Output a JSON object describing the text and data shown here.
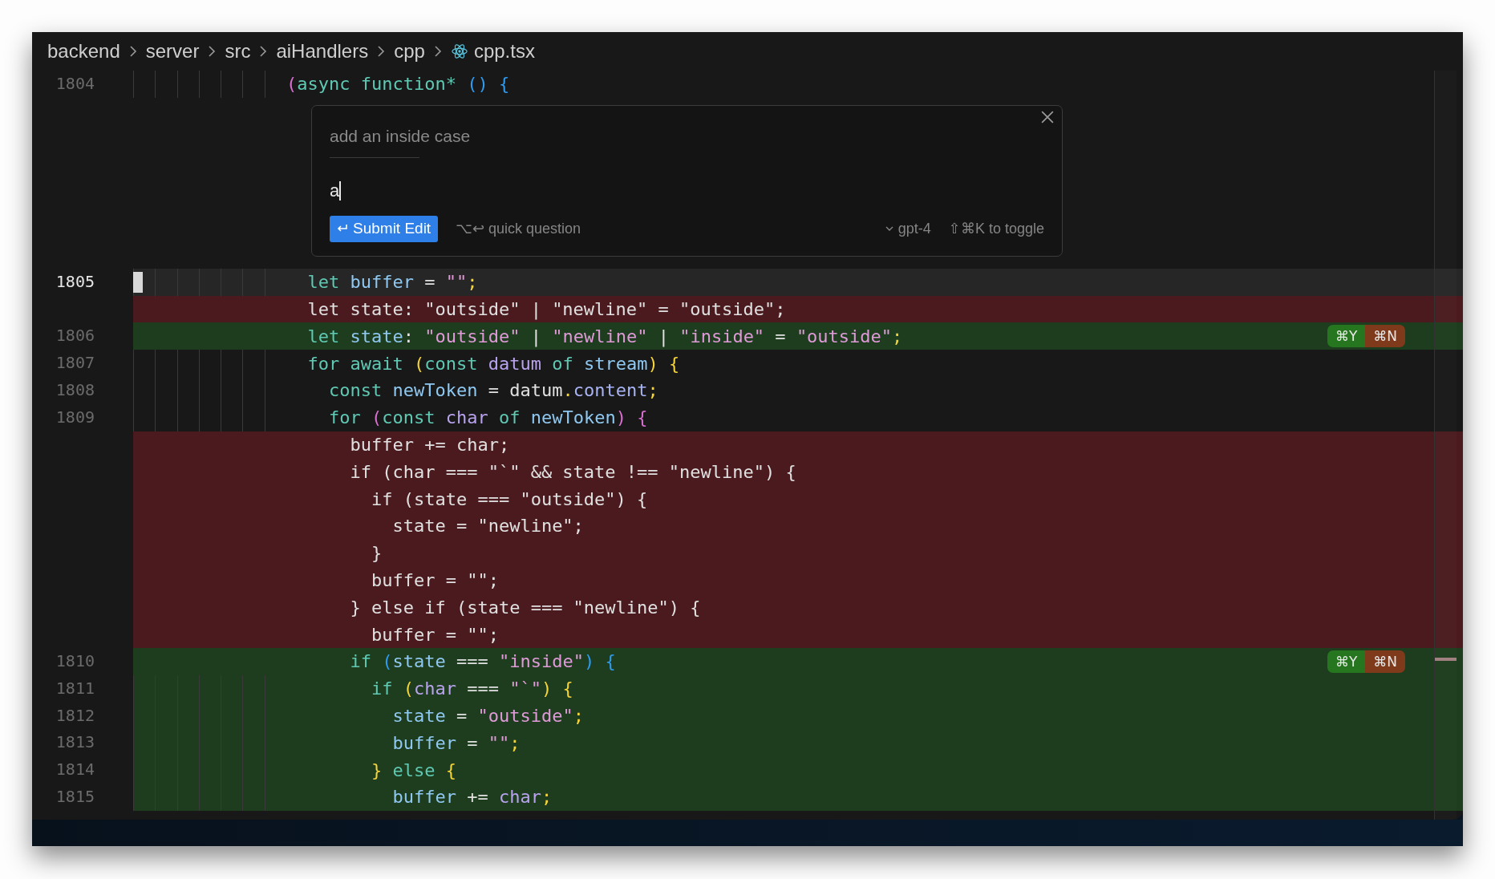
{
  "breadcrumb": [
    {
      "label": "backend",
      "kind": "folder"
    },
    {
      "label": "server",
      "kind": "folder"
    },
    {
      "label": "src",
      "kind": "folder"
    },
    {
      "label": "aiHandlers",
      "kind": "folder"
    },
    {
      "label": "cpp",
      "kind": "folder"
    },
    {
      "label": "cpp.tsx",
      "kind": "file"
    }
  ],
  "code_above": [
    {
      "number": "1804",
      "guides": true,
      "tokens": [
        {
          "text": "(",
          "color": "#d86fd0"
        },
        {
          "text": "async function*",
          "color": "#5fc9b4"
        },
        {
          "text": " ()",
          "color": "#2f9bf0"
        },
        {
          "text": " {",
          "color": "#2f9bf0"
        }
      ]
    }
  ],
  "inline_edit": {
    "previous_prompt": "add an inside case",
    "value": "a",
    "submit_label": "Submit Edit",
    "quick_question": "⌥↩ quick question",
    "model": "gpt-4",
    "toggle_hint": "⇧⌘K to toggle"
  },
  "code_below": [
    {
      "number": "1805",
      "kind": "current",
      "guides": true,
      "tokens": [
        {
          "text": "  let",
          "color": "#5fc9b4"
        },
        {
          "text": " buffer",
          "color": "#8fc8f0"
        },
        {
          "text": " = ",
          "color": "#e0e0e0"
        },
        {
          "text": "\"\"",
          "color": "#e09ad8"
        },
        {
          "text": ";",
          "color": "#f5d33a"
        }
      ]
    },
    {
      "kind": "removed",
      "guides": false,
      "tokens": [
        {
          "text": "  let state: \"outside\" | \"newline\" = \"outside\";",
          "color": "#e0e0e0"
        }
      ]
    },
    {
      "number": "1806",
      "kind": "added",
      "guides": false,
      "tokens": [
        {
          "text": "  let",
          "color": "#5fc9b4"
        },
        {
          "text": " state",
          "color": "#8fc8f0"
        },
        {
          "text": ": ",
          "color": "#e0e0e0"
        },
        {
          "text": "\"outside\"",
          "color": "#e09ad8"
        },
        {
          "text": " | ",
          "color": "#e0e0e0"
        },
        {
          "text": "\"newline\"",
          "color": "#e09ad8"
        },
        {
          "text": " | ",
          "color": "#e0e0e0"
        },
        {
          "text": "\"inside\"",
          "color": "#e09ad8"
        },
        {
          "text": " = ",
          "color": "#e0e0e0"
        },
        {
          "text": "\"outside\"",
          "color": "#e09ad8"
        },
        {
          "text": ";",
          "color": "#f5d33a"
        }
      ],
      "actions": [
        {
          "label": "⌘Y",
          "kind": "accept"
        },
        {
          "label": "⌘N",
          "kind": "reject"
        }
      ]
    },
    {
      "number": "1807",
      "kind": "normal",
      "guides": true,
      "tokens": [
        {
          "text": "  for await",
          "color": "#5fc9b4"
        },
        {
          "text": " (",
          "color": "#f5d33a"
        },
        {
          "text": "const",
          "color": "#5fc9b4"
        },
        {
          "text": " datum",
          "color": "#b9a3ee"
        },
        {
          "text": " of",
          "color": "#5fc9b4"
        },
        {
          "text": " stream",
          "color": "#8fc8f0"
        },
        {
          "text": ")",
          "color": "#f5d33a"
        },
        {
          "text": " {",
          "color": "#f5d33a"
        }
      ]
    },
    {
      "number": "1808",
      "kind": "normal",
      "guides": true,
      "tokens": [
        {
          "text": "    const",
          "color": "#5fc9b4"
        },
        {
          "text": " newToken",
          "color": "#8fc8f0"
        },
        {
          "text": " = datum",
          "color": "#e0e0e0"
        },
        {
          "text": ".",
          "color": "#f5d33a"
        },
        {
          "text": "content",
          "color": "#a8b4f4"
        },
        {
          "text": ";",
          "color": "#f5d33a"
        }
      ]
    },
    {
      "number": "1809",
      "kind": "normal",
      "guides": true,
      "tokens": [
        {
          "text": "    for",
          "color": "#5fc9b4"
        },
        {
          "text": " (",
          "color": "#d86fd0"
        },
        {
          "text": "const",
          "color": "#5fc9b4"
        },
        {
          "text": " char",
          "color": "#b9a3ee"
        },
        {
          "text": " of",
          "color": "#5fc9b4"
        },
        {
          "text": " newToken",
          "color": "#8fc8f0"
        },
        {
          "text": ")",
          "color": "#d86fd0"
        },
        {
          "text": " {",
          "color": "#d86fd0"
        }
      ]
    },
    {
      "kind": "removed",
      "guides": false,
      "tokens": [
        {
          "text": "      buffer += char;",
          "color": "#e0e0e0"
        }
      ]
    },
    {
      "kind": "removed",
      "guides": false,
      "tokens": [
        {
          "text": "      if (char === \"`\" && state !== \"newline\") {",
          "color": "#e0e0e0"
        }
      ]
    },
    {
      "kind": "removed",
      "guides": false,
      "tokens": [
        {
          "text": "        if (state === \"outside\") {",
          "color": "#e0e0e0"
        }
      ]
    },
    {
      "kind": "removed",
      "guides": false,
      "tokens": [
        {
          "text": "          state = \"newline\";",
          "color": "#e0e0e0"
        }
      ]
    },
    {
      "kind": "removed",
      "guides": false,
      "tokens": [
        {
          "text": "        }",
          "color": "#e0e0e0"
        }
      ]
    },
    {
      "kind": "removed",
      "guides": false,
      "tokens": [
        {
          "text": "        buffer = \"\";",
          "color": "#e0e0e0"
        }
      ]
    },
    {
      "kind": "removed",
      "guides": false,
      "tokens": [
        {
          "text": "      } else if (state === \"newline\") {",
          "color": "#e0e0e0"
        }
      ]
    },
    {
      "kind": "removed",
      "guides": false,
      "tokens": [
        {
          "text": "        buffer = \"\";",
          "color": "#e0e0e0"
        }
      ]
    },
    {
      "number": "1810",
      "kind": "added",
      "guides": false,
      "tokens": [
        {
          "text": "      if",
          "color": "#5fc9b4"
        },
        {
          "text": " (",
          "color": "#2f9bf0"
        },
        {
          "text": "state",
          "color": "#8fc8f0"
        },
        {
          "text": " === ",
          "color": "#e0e0e0"
        },
        {
          "text": "\"inside\"",
          "color": "#e09ad8"
        },
        {
          "text": ")",
          "color": "#2f9bf0"
        },
        {
          "text": " {",
          "color": "#2f9bf0"
        }
      ],
      "actions": [
        {
          "label": "⌘Y",
          "kind": "accept"
        },
        {
          "label": "⌘N",
          "kind": "reject"
        }
      ]
    },
    {
      "number": "1811",
      "kind": "added",
      "guides": true,
      "tokens": [
        {
          "text": "        if",
          "color": "#5fc9b4"
        },
        {
          "text": " (",
          "color": "#f5d33a"
        },
        {
          "text": "char",
          "color": "#b9a3ee"
        },
        {
          "text": " === ",
          "color": "#e0e0e0"
        },
        {
          "text": "\"`\"",
          "color": "#e09ad8"
        },
        {
          "text": ")",
          "color": "#f5d33a"
        },
        {
          "text": " {",
          "color": "#f5d33a"
        }
      ]
    },
    {
      "number": "1812",
      "kind": "added",
      "guides": true,
      "tokens": [
        {
          "text": "          state",
          "color": "#8fc8f0"
        },
        {
          "text": " = ",
          "color": "#e0e0e0"
        },
        {
          "text": "\"outside\"",
          "color": "#e09ad8"
        },
        {
          "text": ";",
          "color": "#f5d33a"
        }
      ]
    },
    {
      "number": "1813",
      "kind": "added",
      "guides": true,
      "tokens": [
        {
          "text": "          buffer",
          "color": "#8fc8f0"
        },
        {
          "text": " = ",
          "color": "#e0e0e0"
        },
        {
          "text": "\"\"",
          "color": "#e09ad8"
        },
        {
          "text": ";",
          "color": "#f5d33a"
        }
      ]
    },
    {
      "number": "1814",
      "kind": "added",
      "guides": true,
      "tokens": [
        {
          "text": "        }",
          "color": "#f5d33a"
        },
        {
          "text": " else",
          "color": "#5fc9b4"
        },
        {
          "text": " {",
          "color": "#f5d33a"
        }
      ]
    },
    {
      "number": "1815",
      "kind": "added",
      "guides": true,
      "tokens": [
        {
          "text": "          buffer",
          "color": "#8fc8f0"
        },
        {
          "text": " += ",
          "color": "#e0e0e0"
        },
        {
          "text": "char",
          "color": "#b9a3ee"
        },
        {
          "text": ";",
          "color": "#f5d33a"
        }
      ]
    }
  ]
}
